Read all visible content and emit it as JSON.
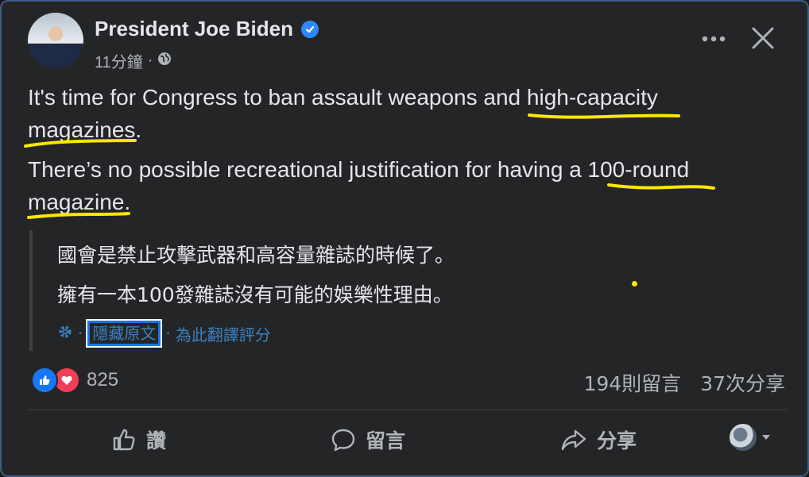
{
  "post": {
    "author": "President Joe Biden",
    "time": "11分鐘",
    "separator": "·",
    "paragraphs": [
      "It's time for Congress to ban assault weapons and high-capacity magazines.",
      "There’s no possible recreational justification for having a 100-round magazine."
    ],
    "translation": {
      "lines": [
        "國會是禁止攻擊武器和高容量雜誌的時候了。",
        "擁有一本100發雜誌沒有可能的娛樂性理由。"
      ],
      "hide_original": "隱藏原文",
      "rate_translation": "為此翻譯評分",
      "dot": "·"
    }
  },
  "engagement": {
    "reaction_count": "825",
    "comments": "194則留言",
    "shares": "37次分享"
  },
  "actions": {
    "like": "讚",
    "comment": "留言",
    "share": "分享"
  },
  "colors": {
    "background": "#242526",
    "text": "#e4e6eb",
    "secondary": "#b0b3b8",
    "link": "#3b82c4",
    "verified": "#2d88ff",
    "highlight_ink": "#ffe600"
  },
  "icons": [
    "verified-badge-icon",
    "globe-icon",
    "more-icon",
    "close-icon",
    "gear-icon",
    "like-reaction-icon",
    "love-reaction-icon",
    "thumb-up-icon",
    "comment-icon",
    "share-icon",
    "caret-down-icon"
  ]
}
